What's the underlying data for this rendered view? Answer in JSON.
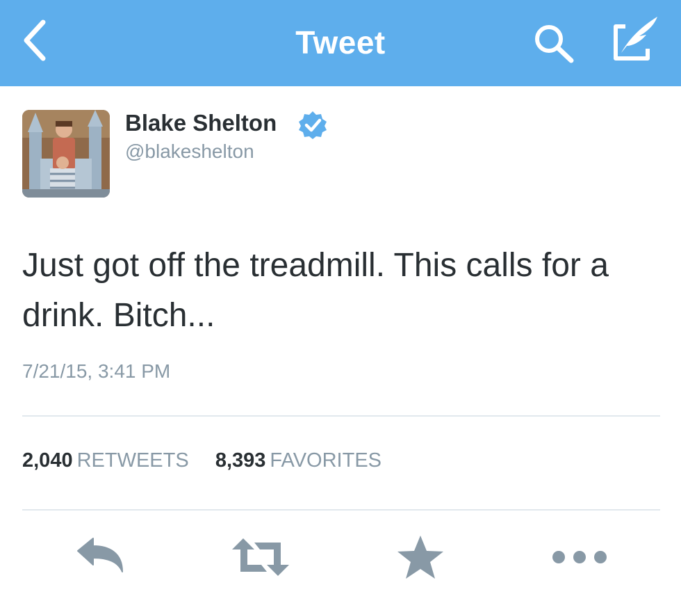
{
  "navbar": {
    "title": "Tweet",
    "back_icon": "chevron-left-icon",
    "search_icon": "search-icon",
    "compose_icon": "compose-icon",
    "background_color": "#5eaeec"
  },
  "author": {
    "name": "Blake Shelton",
    "handle": "@blakeshelton",
    "verified": true,
    "verified_color": "#5eaeec"
  },
  "tweet": {
    "text": "Just got off the treadmill. This calls for a drink. Bitch...",
    "timestamp": "7/21/15, 3:41 PM"
  },
  "stats": {
    "retweets_count": "2,040",
    "retweets_label": "RETWEETS",
    "favorites_count": "8,393",
    "favorites_label": "FAVORITES"
  },
  "actions": [
    {
      "name": "reply",
      "icon": "reply-icon"
    },
    {
      "name": "retweet",
      "icon": "retweet-icon"
    },
    {
      "name": "favorite",
      "icon": "star-icon"
    },
    {
      "name": "more",
      "icon": "more-icon"
    }
  ]
}
